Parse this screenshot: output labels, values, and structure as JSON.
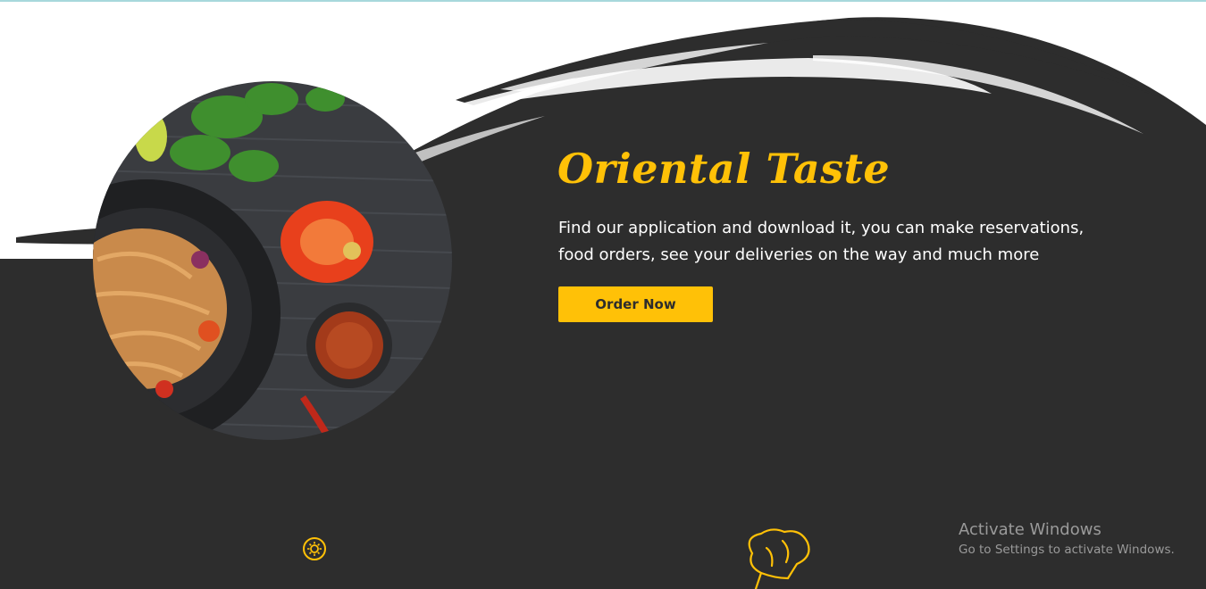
{
  "hero": {
    "title": "Oriental Taste",
    "description_line1": "Find our application and download it, you can make reservations,",
    "description_line2": "food orders, see your deliveries on the way and much more",
    "order_button_label": "Order Now"
  },
  "features": {
    "left_icon": "sun-icon",
    "right_icon": "chef-hat-icon"
  },
  "watermark": {
    "title": "Activate Windows",
    "subtitle": "Go to Settings to activate Windows."
  },
  "colors": {
    "accent": "#ffc107",
    "dark": "#2d2d2d",
    "text_light": "#ffffff"
  }
}
